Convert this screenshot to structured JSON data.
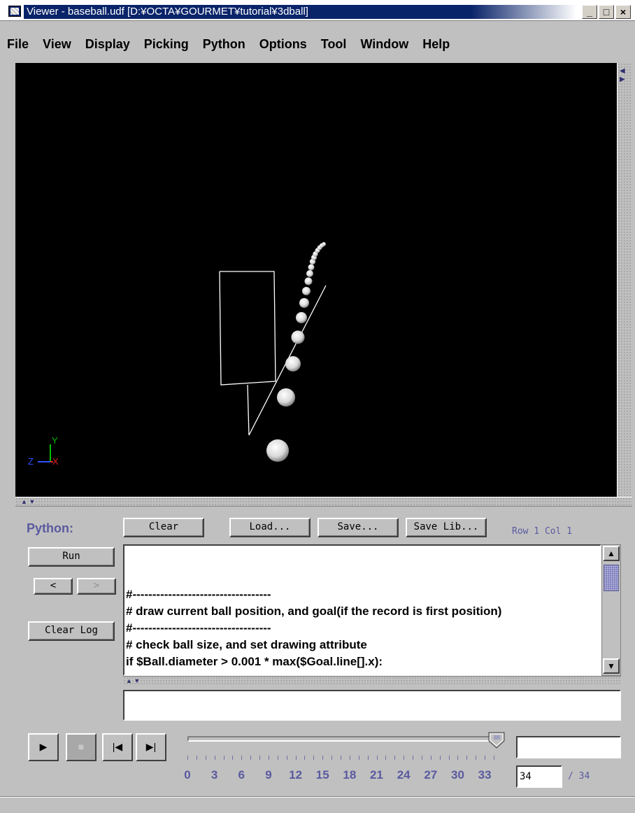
{
  "window": {
    "title": "Viewer - baseball.udf [D:¥OCTA¥GOURMET¥tutorial¥3dball]",
    "minimize_label": "_",
    "maximize_label": "□",
    "close_label": "×"
  },
  "menu": [
    "File",
    "View",
    "Display",
    "Picking",
    "Python",
    "Options",
    "Tool",
    "Window",
    "Help"
  ],
  "viewport": {
    "axis_labels": {
      "y": "Y",
      "z": "Z",
      "x": "X"
    },
    "axis_colors": {
      "y": "#00c000",
      "z": "#3050ff",
      "x": "#e02020"
    }
  },
  "python_panel": {
    "label": "Python:",
    "clear_label": "Clear",
    "load_label": "Load...",
    "save_label": "Save...",
    "save_lib_label": "Save Lib...",
    "row_col": "Row 1 Col 1",
    "run_label": "Run",
    "prev_label": "<",
    "next_label": ">",
    "clear_log_label": "Clear Log",
    "code_lines": [
      "#-----------------------------------",
      "# draw current ball position, and goal(if the record is first position)",
      "#-----------------------------------",
      "# check ball size, and set drawing attribute",
      "if $Ball.diameter > 0.001 * max($Goal.line[].x):"
    ],
    "command_input": ""
  },
  "playback": {
    "tick_labels": [
      "0",
      "3",
      "6",
      "9",
      "12",
      "15",
      "18",
      "21",
      "24",
      "27",
      "30",
      "33"
    ],
    "slider_value": 34,
    "slider_max": 34,
    "frame_field": "34",
    "total_label": "/ 34",
    "top_field": ""
  }
}
